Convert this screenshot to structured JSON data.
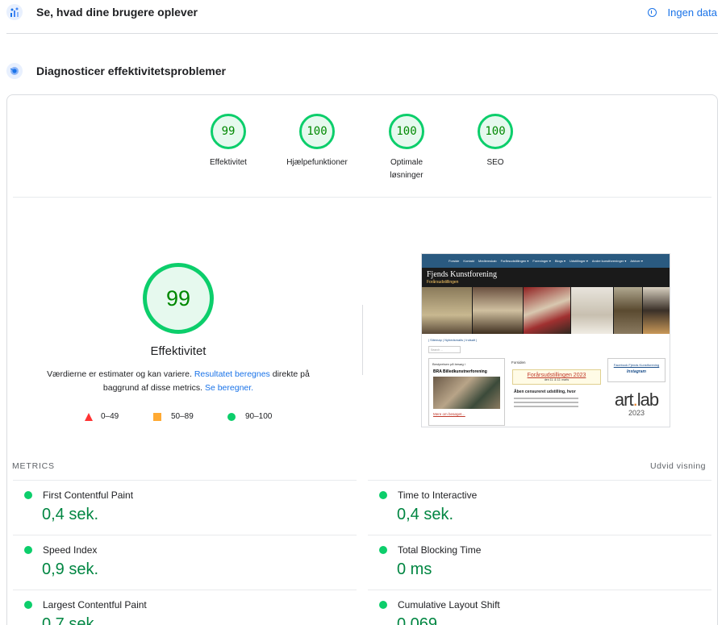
{
  "sections": {
    "field": {
      "title": "Se, hvad dine brugere oplever",
      "no_data": "Ingen data"
    },
    "lab": {
      "title": "Diagnosticer effektivitetsproblemer"
    }
  },
  "category_gauges": [
    {
      "score": "99",
      "label": "Effektivitet"
    },
    {
      "score": "100",
      "label": "Hjælpefunktioner"
    },
    {
      "score": "100",
      "label": "Optimale løsninger"
    },
    {
      "score": "100",
      "label": "SEO"
    }
  ],
  "performance": {
    "score": "99",
    "title": "Effektivitet",
    "desc_pre": "Værdierne er estimater og kan variere. ",
    "desc_link1": "Resultatet beregnes",
    "desc_mid": " direkte på baggrund af disse metrics. ",
    "desc_link2": "Se beregner."
  },
  "legend": [
    {
      "range": "0–49",
      "color": "#ff3333",
      "shape": "triangle"
    },
    {
      "range": "50–89",
      "color": "#ffaa33",
      "shape": "square"
    },
    {
      "range": "90–100",
      "color": "#0cce6b",
      "shape": "circle"
    }
  ],
  "thumbnail": {
    "nav": [
      "Forside",
      "Kontakt",
      "Medlemskab",
      "Forårsudstillingen ▾",
      "Foreninger ▾",
      "Blogs ▾",
      "Udstillinger ▾",
      "Andre kunstforeninger ▾",
      "Arkiver ▾"
    ],
    "site_title": "Fjends Kunstforening",
    "site_subtitle": "Forårsudstillingen",
    "breadcrumb": "| Sitemap | Nyhedsmails | Indsalt |",
    "search_placeholder": "Search ...",
    "left_box_title": "Bestyrelsen på besøg i",
    "left_box_bra": "BRA Billedkunstnerforening",
    "left_box_more": "Mere om besøget…",
    "center_title": "Forsiden",
    "center_headline": "Forårsudstillingen 2023",
    "center_date": "den 11. & 12. marts",
    "center_h2": "Åben censureret udstilling, hvor",
    "right_fb": "Facebook Fjends Kunstforening",
    "right_ig": "Instagram",
    "logo_left": "art",
    "logo_dot": ".",
    "logo_right": "lab",
    "logo_year": "2023"
  },
  "metrics_header": {
    "label": "METRICS",
    "expand": "Udvid visning"
  },
  "metrics": [
    {
      "name": "First Contentful Paint",
      "value": "0,4 sek.",
      "status_color": "#0cce6b"
    },
    {
      "name": "Time to Interactive",
      "value": "0,4 sek.",
      "status_color": "#0cce6b"
    },
    {
      "name": "Speed Index",
      "value": "0,9 sek.",
      "status_color": "#0cce6b"
    },
    {
      "name": "Total Blocking Time",
      "value": "0 ms",
      "status_color": "#0cce6b"
    },
    {
      "name": "Largest Contentful Paint",
      "value": "0,7 sek.",
      "status_color": "#0cce6b"
    },
    {
      "name": "Cumulative Layout Shift",
      "value": "0,069",
      "status_color": "#0cce6b"
    }
  ]
}
